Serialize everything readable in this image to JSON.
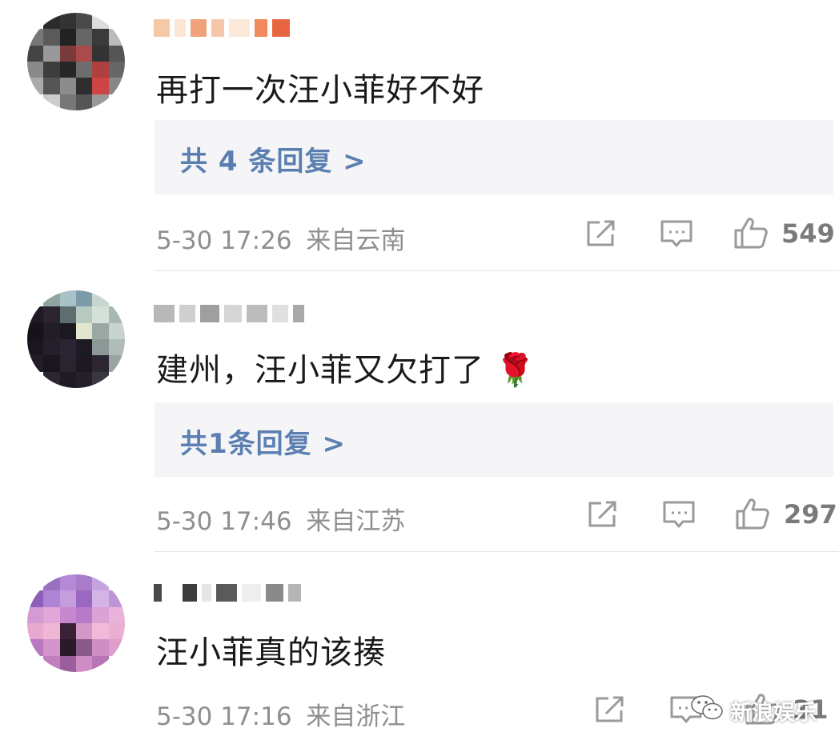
{
  "comments": [
    {
      "text": "再打一次汪小菲好不好",
      "reply_label": "共 4 条回复 >",
      "timestamp": "5-30 17:26",
      "location": "来自云南",
      "likes": "549"
    },
    {
      "text": "建州，汪小菲又欠打了",
      "emoji": "🌹",
      "reply_label": "共1条回复 >",
      "timestamp": "5-30 17:46",
      "location": "来自江苏",
      "likes": "297"
    },
    {
      "text": "汪小菲真的该揍",
      "timestamp": "5-30 17:16",
      "location": "来自浙江",
      "likes": "31"
    }
  ],
  "watermark": {
    "label": "新浪娱乐",
    "icon": "wechat-icon"
  },
  "icons": {
    "share": "share-icon",
    "reply": "comment-icon",
    "like": "thumbs-up-icon"
  },
  "colors": {
    "reply_link": "#5b7fb0",
    "meta": "#8f8f8f",
    "reply_bg": "#f5f5f7"
  }
}
